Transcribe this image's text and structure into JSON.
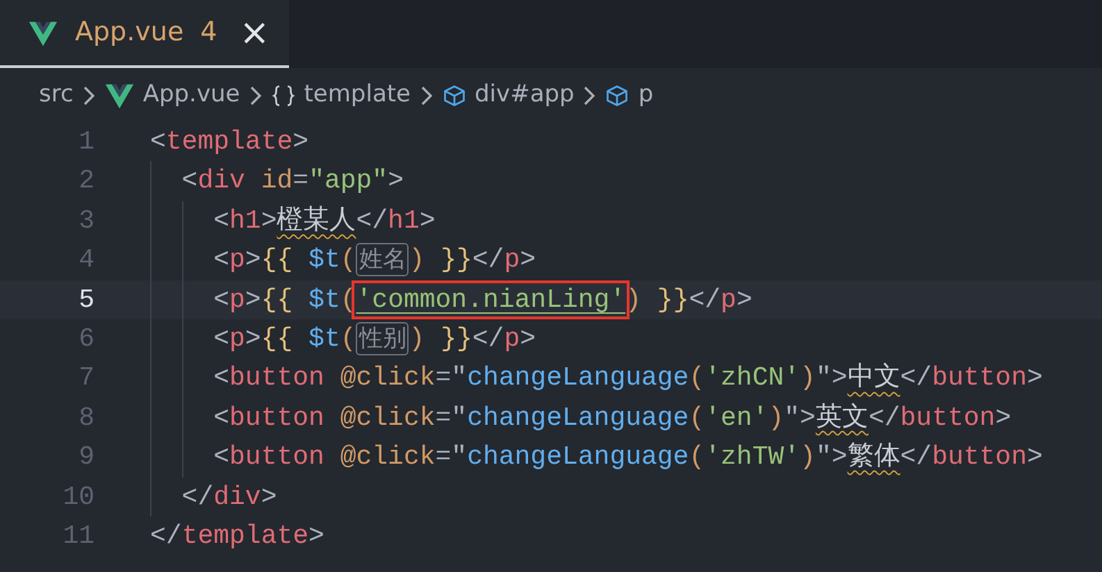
{
  "tab": {
    "label": "App.vue",
    "problems": "4",
    "close": "×",
    "selected": true
  },
  "breadcrumbs": [
    {
      "label": "src",
      "kind": "folder"
    },
    {
      "label": "App.vue",
      "kind": "file"
    },
    {
      "label": "template",
      "kind": "section"
    },
    {
      "label": "div#app",
      "kind": "element"
    },
    {
      "label": "p",
      "kind": "element"
    }
  ],
  "lines": [
    {
      "number": "1",
      "current": false,
      "tokens": [
        {
          "kind": "punct",
          "text": "<"
        },
        {
          "kind": "tag",
          "text": "template"
        },
        {
          "kind": "punct",
          "text": ">"
        }
      ]
    },
    {
      "number": "2",
      "current": false,
      "tokens": [
        {
          "kind": "punct",
          "text": "  <"
        },
        {
          "kind": "tag",
          "text": "div"
        },
        {
          "kind": "attr",
          "text": " id"
        },
        {
          "kind": "punct",
          "text": "="
        },
        {
          "kind": "string",
          "text": "\"app\""
        },
        {
          "kind": "punct",
          "text": ">"
        }
      ]
    },
    {
      "number": "3",
      "current": false,
      "tokens": [
        {
          "kind": "punct",
          "text": "    <"
        },
        {
          "kind": "tag",
          "text": "h1"
        },
        {
          "kind": "punct",
          "text": ">"
        },
        {
          "kind": "text",
          "text": "橙某人",
          "squiggle": true
        },
        {
          "kind": "punct",
          "text": "</"
        },
        {
          "kind": "tag",
          "text": "h1"
        },
        {
          "kind": "punct",
          "text": ">"
        }
      ]
    },
    {
      "number": "4",
      "current": false,
      "tokens": [
        {
          "kind": "punct",
          "text": "    <"
        },
        {
          "kind": "tag",
          "text": "p"
        },
        {
          "kind": "punct",
          "text": ">"
        },
        {
          "kind": "brace",
          "text": "{{ "
        },
        {
          "kind": "var",
          "text": "$t"
        },
        {
          "kind": "paren",
          "text": "("
        },
        {
          "kind": "hint",
          "text": "姓名"
        },
        {
          "kind": "paren",
          "text": ")"
        },
        {
          "kind": "brace",
          "text": " }}"
        },
        {
          "kind": "punct",
          "text": "</"
        },
        {
          "kind": "tag",
          "text": "p"
        },
        {
          "kind": "punct",
          "text": ">"
        }
      ]
    },
    {
      "number": "5",
      "current": true,
      "tokens": [
        {
          "kind": "punct",
          "text": "    <"
        },
        {
          "kind": "tag",
          "text": "p"
        },
        {
          "kind": "punct",
          "text": ">"
        },
        {
          "kind": "brace",
          "text": "{{ "
        },
        {
          "kind": "var",
          "text": "$t"
        },
        {
          "kind": "paren",
          "text": "("
        },
        {
          "kind": "string",
          "text": "'common.nianLing'",
          "underline": true,
          "boxed": true
        },
        {
          "kind": "paren",
          "text": ")"
        },
        {
          "kind": "brace",
          "text": " }}"
        },
        {
          "kind": "punct",
          "text": "</"
        },
        {
          "kind": "tag",
          "text": "p"
        },
        {
          "kind": "punct",
          "text": ">"
        }
      ]
    },
    {
      "number": "6",
      "current": false,
      "tokens": [
        {
          "kind": "punct",
          "text": "    <"
        },
        {
          "kind": "tag",
          "text": "p"
        },
        {
          "kind": "punct",
          "text": ">"
        },
        {
          "kind": "brace",
          "text": "{{ "
        },
        {
          "kind": "var",
          "text": "$t"
        },
        {
          "kind": "paren",
          "text": "("
        },
        {
          "kind": "hint",
          "text": "性别"
        },
        {
          "kind": "paren",
          "text": ")"
        },
        {
          "kind": "brace",
          "text": " }}"
        },
        {
          "kind": "punct",
          "text": "</"
        },
        {
          "kind": "tag",
          "text": "p"
        },
        {
          "kind": "punct",
          "text": ">"
        }
      ]
    },
    {
      "number": "7",
      "current": false,
      "tokens": [
        {
          "kind": "punct",
          "text": "    <"
        },
        {
          "kind": "tag",
          "text": "button"
        },
        {
          "kind": "attr",
          "text": " @click"
        },
        {
          "kind": "punct",
          "text": "=\""
        },
        {
          "kind": "var",
          "text": "changeLanguage"
        },
        {
          "kind": "paren",
          "text": "("
        },
        {
          "kind": "string",
          "text": "'zhCN'"
        },
        {
          "kind": "paren",
          "text": ")"
        },
        {
          "kind": "punct",
          "text": "\">"
        },
        {
          "kind": "text",
          "text": "中文",
          "squiggle": true
        },
        {
          "kind": "punct",
          "text": "</"
        },
        {
          "kind": "tag",
          "text": "button"
        },
        {
          "kind": "punct",
          "text": ">"
        }
      ]
    },
    {
      "number": "8",
      "current": false,
      "tokens": [
        {
          "kind": "punct",
          "text": "    <"
        },
        {
          "kind": "tag",
          "text": "button"
        },
        {
          "kind": "attr",
          "text": " @click"
        },
        {
          "kind": "punct",
          "text": "=\""
        },
        {
          "kind": "var",
          "text": "changeLanguage"
        },
        {
          "kind": "paren",
          "text": "("
        },
        {
          "kind": "string",
          "text": "'en'"
        },
        {
          "kind": "paren",
          "text": ")"
        },
        {
          "kind": "punct",
          "text": "\">"
        },
        {
          "kind": "text",
          "text": "英文",
          "squiggle": true
        },
        {
          "kind": "punct",
          "text": "</"
        },
        {
          "kind": "tag",
          "text": "button"
        },
        {
          "kind": "punct",
          "text": ">"
        }
      ]
    },
    {
      "number": "9",
      "current": false,
      "tokens": [
        {
          "kind": "punct",
          "text": "    <"
        },
        {
          "kind": "tag",
          "text": "button"
        },
        {
          "kind": "attr",
          "text": " @click"
        },
        {
          "kind": "punct",
          "text": "=\""
        },
        {
          "kind": "var",
          "text": "changeLanguage"
        },
        {
          "kind": "paren",
          "text": "("
        },
        {
          "kind": "string",
          "text": "'zhTW'"
        },
        {
          "kind": "paren",
          "text": ")"
        },
        {
          "kind": "punct",
          "text": "\">"
        },
        {
          "kind": "text",
          "text": "繁体",
          "squiggle": true
        },
        {
          "kind": "punct",
          "text": "</"
        },
        {
          "kind": "tag",
          "text": "button"
        },
        {
          "kind": "punct",
          "text": ">"
        }
      ]
    },
    {
      "number": "10",
      "current": false,
      "tokens": [
        {
          "kind": "punct",
          "text": "  </"
        },
        {
          "kind": "tag",
          "text": "div"
        },
        {
          "kind": "punct",
          "text": ">"
        }
      ]
    },
    {
      "number": "11",
      "current": false,
      "tokens": [
        {
          "kind": "punct",
          "text": "</"
        },
        {
          "kind": "tag",
          "text": "template"
        },
        {
          "kind": "punct",
          "text": ">"
        }
      ]
    }
  ]
}
